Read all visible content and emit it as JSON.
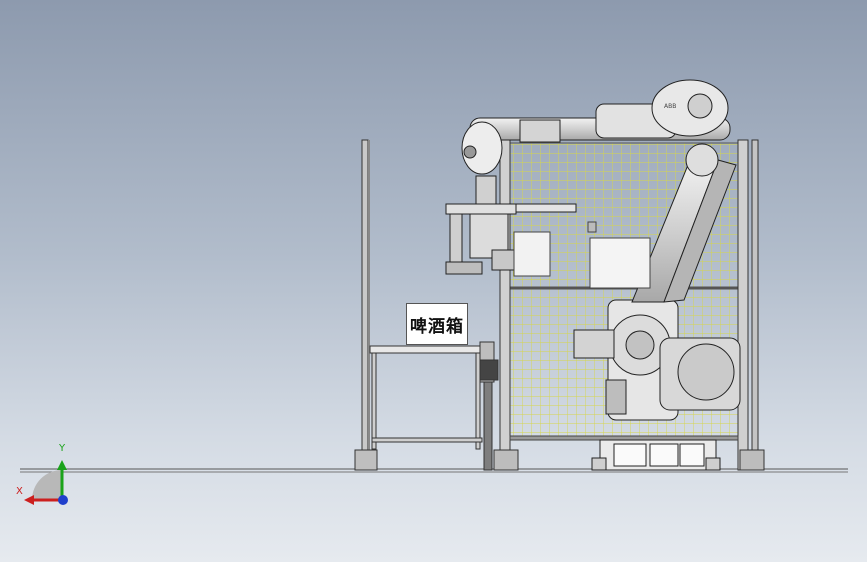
{
  "label": {
    "text": "啤酒箱"
  },
  "triad": {
    "x_label": "X",
    "y_label": "Y",
    "x_color": "#cc1f1f",
    "y_color": "#1aa31a",
    "z_color": "#1f3fcc"
  },
  "robot": {
    "brand": "ABB"
  },
  "colors": {
    "fence_mesh": "#d8d84a",
    "frame": "#5c5f64",
    "robot_body": "#e4e4e4",
    "robot_outline": "#222222"
  }
}
